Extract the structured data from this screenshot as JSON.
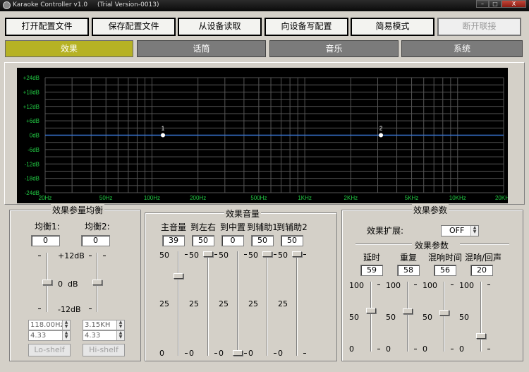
{
  "window": {
    "title": "Karaoke Controller v1.0",
    "trial": "(Trial Version-0013)",
    "min_label": "–",
    "max_label": "□",
    "close_label": "X"
  },
  "toolbar": {
    "open_config": "打开配置文件",
    "save_config": "保存配置文件",
    "read_device": "从设备读取",
    "write_device": "向设备写配置",
    "simple_mode": "简易模式",
    "disconnect": "断开联接"
  },
  "tabs": {
    "effect": "效果",
    "mic": "话筒",
    "music": "音乐",
    "system": "系统"
  },
  "eq_graph": {
    "y_labels": [
      "+24dB",
      "+18dB",
      "+12dB",
      "+6dB",
      "0dB",
      "-6dB",
      "-12dB",
      "-18dB",
      "-24dB"
    ],
    "x_labels": [
      "20Hz",
      "50Hz",
      "100Hz",
      "200Hz",
      "500Hz",
      "1KHz",
      "2KHz",
      "5KHz",
      "10KHz",
      "20KHz"
    ],
    "x_values": [
      20,
      50,
      100,
      200,
      500,
      1000,
      2000,
      5000,
      10000,
      20000
    ],
    "y_range": [
      -24,
      24
    ],
    "points": [
      {
        "label": "1",
        "freq": 118,
        "gain": 0
      },
      {
        "label": "2",
        "freq": 3150,
        "gain": 0
      }
    ],
    "curve_color": "#3a78d8",
    "label_color": "#22cc44",
    "grid_color": "#555555"
  },
  "balance": {
    "title": "效果参量均衡",
    "eq1_label": "均衡1:",
    "eq2_label": "均衡2:",
    "eq1_value": "0",
    "eq2_value": "0",
    "max_label": "+12dB",
    "mid_zero": "0",
    "mid_db": "dB",
    "min_label": "-12dB",
    "eq1_freq": "118.00Hz",
    "eq1_q": "4.33",
    "eq2_freq": "3.15KH",
    "eq2_q": "4.33",
    "eq1_type": "Lo-shelf",
    "eq2_type": "Hi-shelf",
    "eq1_level_db": 0,
    "eq2_level_db": 0
  },
  "volume": {
    "title": "效果音量",
    "channels": [
      {
        "label": "主音量",
        "value": "39",
        "level": 39
      },
      {
        "label": "到左右",
        "value": "50",
        "level": 50
      },
      {
        "label": "到中置",
        "value": "0",
        "level": 0
      },
      {
        "label": "到辅助1",
        "value": "50",
        "level": 50
      },
      {
        "label": "到辅助2",
        "value": "50",
        "level": 50
      }
    ],
    "scale_max": "50",
    "scale_mid": "25",
    "scale_min": "0"
  },
  "params": {
    "title": "效果参数",
    "ext_label": "效果扩展:",
    "ext_value": "OFF",
    "sub_title": "效果参数",
    "channels": [
      {
        "label": "延时",
        "value": "59",
        "level": 59
      },
      {
        "label": "重复",
        "value": "58",
        "level": 58
      },
      {
        "label": "混响时间",
        "value": "56",
        "level": 56
      },
      {
        "label": "混响/回声",
        "value": "20",
        "level": 20
      }
    ],
    "scale_max": "100",
    "scale_mid": "50",
    "scale_min": "0"
  }
}
